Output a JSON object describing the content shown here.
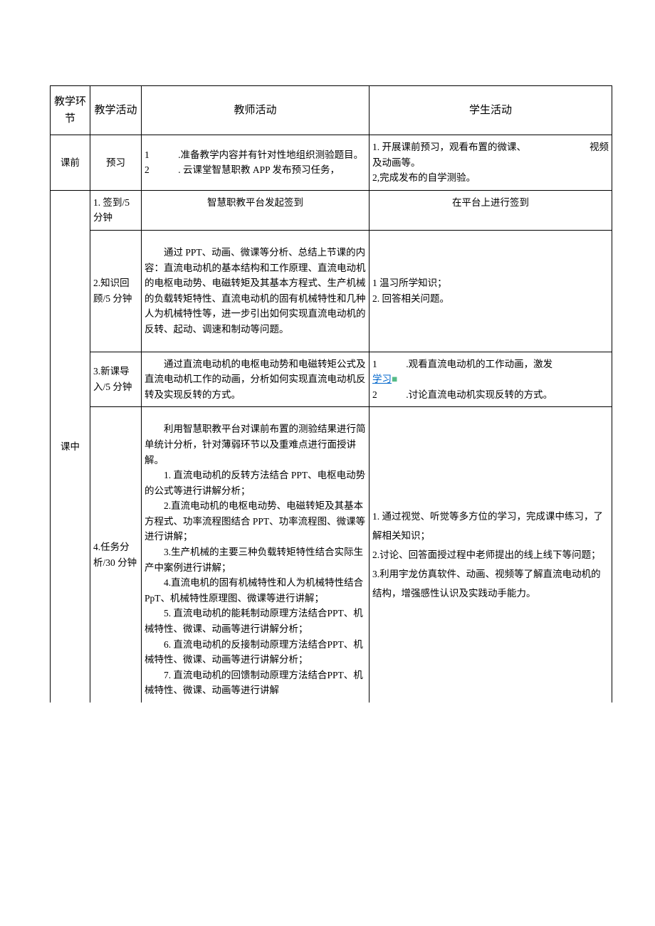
{
  "header": {
    "col1": "教学环节",
    "col2": "教学活动",
    "col3": "教师活动",
    "col4": "学生活动"
  },
  "r1": {
    "phase": "课前",
    "activity": "预习",
    "teacher_l1": "1　　　.准备教学内容并有针对性地组织测验题目。",
    "teacher_l2": "2　　　. 云课堂智慧职教 APP 发布预习任务，",
    "student_l1a": "1. 开展课前预习，观看布置的微课、",
    "student_l1b": "视频",
    "student_l1c": "及动画等。",
    "student_l2": "2,完成发布的自学测验。"
  },
  "r2": {
    "phase": "课中",
    "activity": "1. 签到/5分钟",
    "teacher": "智慧职教平台发起签到",
    "student": "在平台上进行签到"
  },
  "r3": {
    "activity": "2.知识回顾/5 分钟",
    "teacher": "　　通过 PPT、动画、微课等分析、总结上节课的内容：直流电动机的基本结构和工作原理、直流电动机的电枢电动势、电磁转矩及其基本方程式、生产机械的负载转矩特性、直流电动机的固有机械特性和几种人为机械特性等，进一步引出如何实现直流电动机的反转、起动、调速和制动等问题。",
    "student_l1": "1 温习所学知识；",
    "student_l2": "2. 回答相关问题。"
  },
  "r4": {
    "activity": "3.新课导入/5 分钟",
    "teacher": "　　通过直流电动机的电枢电动势和电磁转矩公式及直流电动机工作的动画，分析如何实现直流电动机反转及实现反转的方式。",
    "student_l1": "1　　　.观看直流电动机的工作动画，激发",
    "student_link": "学习",
    "student_linkmark": "■",
    "student_l2": "2　　　.讨论直流电动机实现反转的方式。"
  },
  "r5": {
    "activity": "4.任务分析/30 分钟",
    "t1": "　　利用智慧职教平台对课前布置的测验结果进行简单统计分析，针对薄弱环节以及重难点进行面授讲解。",
    "t2": "　　1. 直流电动机的反转方法结合 PPT、电枢电动势的公式等进行讲解分析；",
    "t3": "　　2.直流电动机的电枢电动势、电磁转矩及其基本方程式、功率流程图结合 PPT、功率流程图、微课等进行讲解；",
    "t4": "　　3.生产机械的主要三种负载转矩特性结合实际生产中案例进行讲解；",
    "t5": "　　4.直流电机的固有机械特性和人为机械特性结合 PpT、机械特性原理图、微课等进行讲解；",
    "t6": "　　5. 直流电动机的能耗制动原理方法结合PPT、机械特性、微课、动画等进行讲解分析；",
    "t7": "　　6. 直流电动机的反接制动原理方法结合PPT、机械特性、微课、动画等进行讲解分析；",
    "t8": "　　7. 直流电动机的回馈制动原理方法结合PPT、机械特性、微课、动画等进行讲解",
    "s1": "1. 通过视觉、听觉等多方位的学习，完成课中练习，了解相关知识；",
    "s2": "2.讨论、回答面授过程中老师提出的线上线下等问题；",
    "s3": "3.利用宇龙仿真软件、动画、视频等了解直流电动机的结构，增强感性认识及实践动手能力。"
  }
}
